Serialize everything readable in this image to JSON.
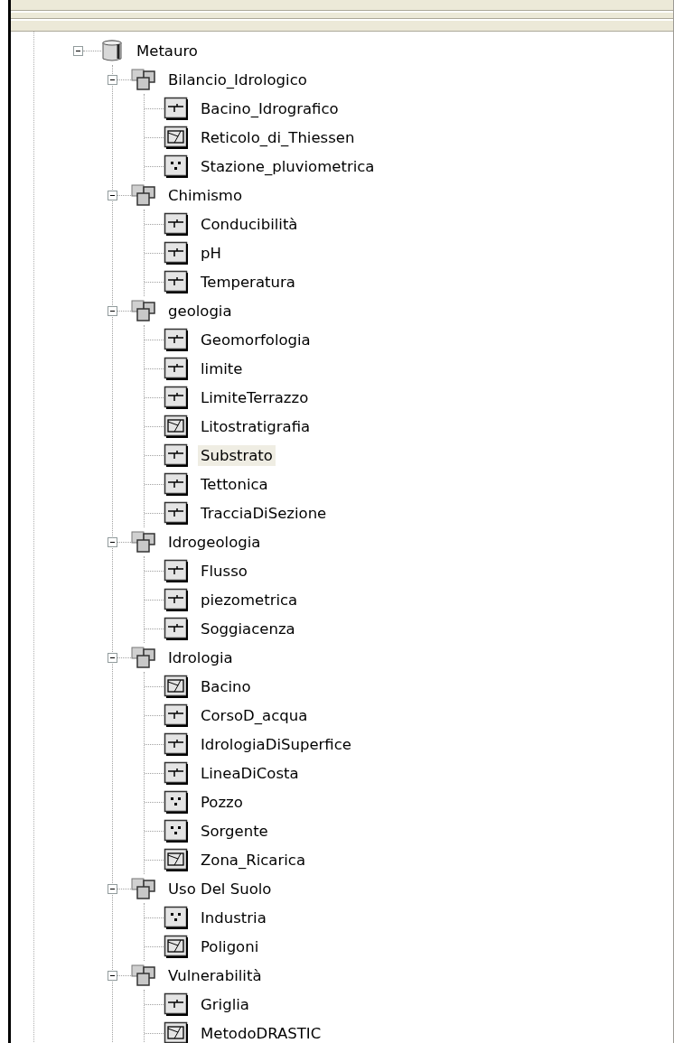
{
  "tree": [
    {
      "label": "Metauro",
      "expanded": true,
      "children": [
        {
          "label": "Bilancio_Idrologico",
          "expanded": true,
          "children": [
            {
              "label": "Bacino_Idrografico",
              "kind": "line",
              "selected": false
            },
            {
              "label": "Reticolo_di_Thiessen",
              "kind": "polygon",
              "selected": false
            },
            {
              "label": "Stazione_pluviometrica",
              "kind": "point",
              "selected": false
            }
          ]
        },
        {
          "label": "Chimismo",
          "expanded": true,
          "children": [
            {
              "label": "Conducibilità",
              "kind": "line",
              "selected": false
            },
            {
              "label": "pH",
              "kind": "line",
              "selected": false
            },
            {
              "label": "Temperatura",
              "kind": "line",
              "selected": false
            }
          ]
        },
        {
          "label": "geologia",
          "expanded": true,
          "children": [
            {
              "label": "Geomorfologia",
              "kind": "line",
              "selected": false
            },
            {
              "label": "limite",
              "kind": "line",
              "selected": false
            },
            {
              "label": "LimiteTerrazzo",
              "kind": "line",
              "selected": false
            },
            {
              "label": "Litostratigrafia",
              "kind": "polygon",
              "selected": false
            },
            {
              "label": "Substrato",
              "kind": "line",
              "selected": true
            },
            {
              "label": "Tettonica",
              "kind": "line",
              "selected": false
            },
            {
              "label": "TracciaDiSezione",
              "kind": "line",
              "selected": false
            }
          ]
        },
        {
          "label": "Idrogeologia",
          "expanded": true,
          "children": [
            {
              "label": "Flusso",
              "kind": "line",
              "selected": false
            },
            {
              "label": "piezometrica",
              "kind": "line",
              "selected": false
            },
            {
              "label": "Soggiacenza",
              "kind": "line",
              "selected": false
            }
          ]
        },
        {
          "label": "Idrologia",
          "expanded": true,
          "children": [
            {
              "label": "Bacino",
              "kind": "polygon",
              "selected": false
            },
            {
              "label": "CorsoD_acqua",
              "kind": "line",
              "selected": false
            },
            {
              "label": "IdrologiaDiSuperfice",
              "kind": "line",
              "selected": false
            },
            {
              "label": "LineaDiCosta",
              "kind": "line",
              "selected": false
            },
            {
              "label": "Pozzo",
              "kind": "point",
              "selected": false
            },
            {
              "label": "Sorgente",
              "kind": "point",
              "selected": false
            },
            {
              "label": "Zona_Ricarica",
              "kind": "polygon",
              "selected": false
            }
          ]
        },
        {
          "label": "Uso Del Suolo",
          "expanded": true,
          "children": [
            {
              "label": "Industria",
              "kind": "point",
              "selected": false
            },
            {
              "label": "Poligoni",
              "kind": "polygon",
              "selected": false
            }
          ]
        },
        {
          "label": "Vulnerabilità",
          "expanded": true,
          "children": [
            {
              "label": "Griglia",
              "kind": "line",
              "selected": false
            },
            {
              "label": "MetodoDRASTIC",
              "kind": "polygon",
              "selected": false
            }
          ]
        }
      ]
    }
  ]
}
